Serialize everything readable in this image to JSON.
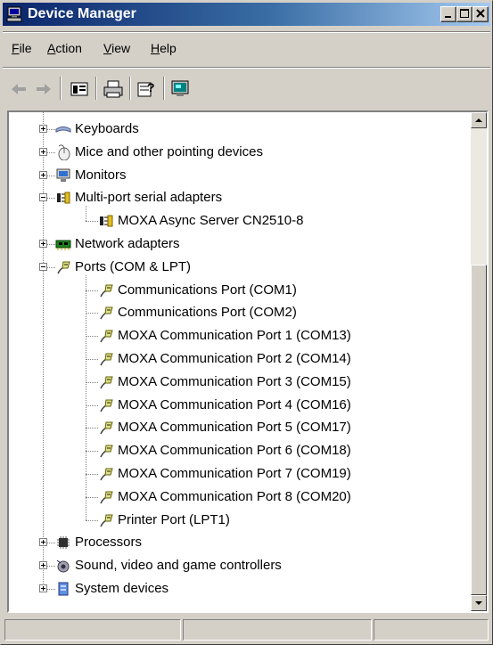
{
  "window": {
    "title": "Device Manager",
    "icon": "computer-icon"
  },
  "title_buttons": [
    "minimize",
    "maximize",
    "close"
  ],
  "menu": [
    {
      "label": "File",
      "accel": "F",
      "rest": "ile"
    },
    {
      "label": "Action",
      "accel": "A",
      "rest": "ction"
    },
    {
      "label": "View",
      "accel": "V",
      "rest": "iew"
    },
    {
      "label": "Help",
      "accel": "H",
      "rest": "elp"
    }
  ],
  "toolbar": {
    "buttons": [
      "back-icon",
      "forward-icon",
      "properties-view-icon",
      "print-icon",
      "help-icon",
      "monitor-icon"
    ]
  },
  "tree": {
    "nodes": [
      {
        "label": "Keyboards",
        "icon": "keyboard-icon",
        "level": 1,
        "expander": "+"
      },
      {
        "label": "Mice and other pointing devices",
        "icon": "mouse-icon",
        "level": 1,
        "expander": "+"
      },
      {
        "label": "Monitors",
        "icon": "monitor-icon",
        "level": 1,
        "expander": "+"
      },
      {
        "label": "Multi-port serial adapters",
        "icon": "serial-adapter-icon",
        "level": 1,
        "expander": "-"
      },
      {
        "label": "MOXA Async Server CN2510-8",
        "icon": "serial-adapter-icon",
        "level": 2,
        "expander": ""
      },
      {
        "label": "Network adapters",
        "icon": "network-card-icon",
        "level": 1,
        "expander": "+"
      },
      {
        "label": "Ports (COM & LPT)",
        "icon": "port-connector-icon",
        "level": 1,
        "expander": "-"
      },
      {
        "label": "Communications Port (COM1)",
        "icon": "port-connector-icon",
        "level": 2,
        "expander": ""
      },
      {
        "label": "Communications Port (COM2)",
        "icon": "port-connector-icon",
        "level": 2,
        "expander": ""
      },
      {
        "label": "MOXA Communication Port 1 (COM13)",
        "icon": "port-connector-icon",
        "level": 2,
        "expander": ""
      },
      {
        "label": "MOXA Communication Port 2 (COM14)",
        "icon": "port-connector-icon",
        "level": 2,
        "expander": ""
      },
      {
        "label": "MOXA Communication Port 3 (COM15)",
        "icon": "port-connector-icon",
        "level": 2,
        "expander": ""
      },
      {
        "label": "MOXA Communication Port 4 (COM16)",
        "icon": "port-connector-icon",
        "level": 2,
        "expander": ""
      },
      {
        "label": "MOXA Communication Port 5 (COM17)",
        "icon": "port-connector-icon",
        "level": 2,
        "expander": ""
      },
      {
        "label": "MOXA Communication Port 6 (COM18)",
        "icon": "port-connector-icon",
        "level": 2,
        "expander": ""
      },
      {
        "label": "MOXA Communication Port 7 (COM19)",
        "icon": "port-connector-icon",
        "level": 2,
        "expander": ""
      },
      {
        "label": "MOXA Communication Port 8 (COM20)",
        "icon": "port-connector-icon",
        "level": 2,
        "expander": ""
      },
      {
        "label": "Printer Port (LPT1)",
        "icon": "port-connector-icon",
        "level": 2,
        "expander": ""
      },
      {
        "label": "Processors",
        "icon": "processor-icon",
        "level": 1,
        "expander": "+"
      },
      {
        "label": "Sound, video and game controllers",
        "icon": "speaker-icon",
        "level": 1,
        "expander": "+"
      },
      {
        "label": "System devices",
        "icon": "system-device-icon",
        "level": 1,
        "expander": "+"
      }
    ]
  },
  "statusbar": {
    "panels": [
      "",
      "",
      ""
    ]
  },
  "colors": {
    "title_start": "#0a246a",
    "title_end": "#a6caf0",
    "face": "#d4d0c8"
  }
}
